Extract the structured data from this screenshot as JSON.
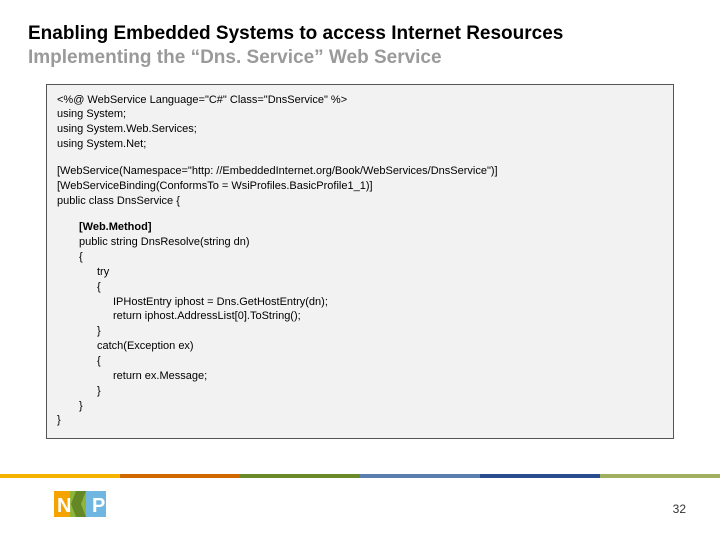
{
  "title": "Enabling Embedded Systems to access Internet Resources",
  "subtitle": "Implementing the “Dns. Service” Web Service",
  "code": {
    "l1": "<%@ WebService Language=\"C#\" Class=\"DnsService\" %>",
    "l2": "using System;",
    "l3": "using System.Web.Services;",
    "l4": "using System.Net;",
    "l5": "[WebService(Namespace=\"http: //EmbeddedInternet.org/Book/WebServices/DnsService\")]",
    "l6": "[WebServiceBinding(ConformsTo = WsiProfiles.BasicProfile1_1)]",
    "l7": "public class DnsService {",
    "l8": "[Web.Method]",
    "l9": "public string DnsResolve(string dn)",
    "l10": "{",
    "l11": "try",
    "l12": "{",
    "l13": "IPHostEntry iphost = Dns.GetHostEntry(dn);",
    "l14": "return iphost.AddressList[0].ToString();",
    "l15": "}",
    "l16": "catch(Exception ex)",
    "l17": "{",
    "l18": "return ex.Message;",
    "l19": "}",
    "l20": "}",
    "l21": "}"
  },
  "page_number": "32",
  "logo_text": "NP"
}
